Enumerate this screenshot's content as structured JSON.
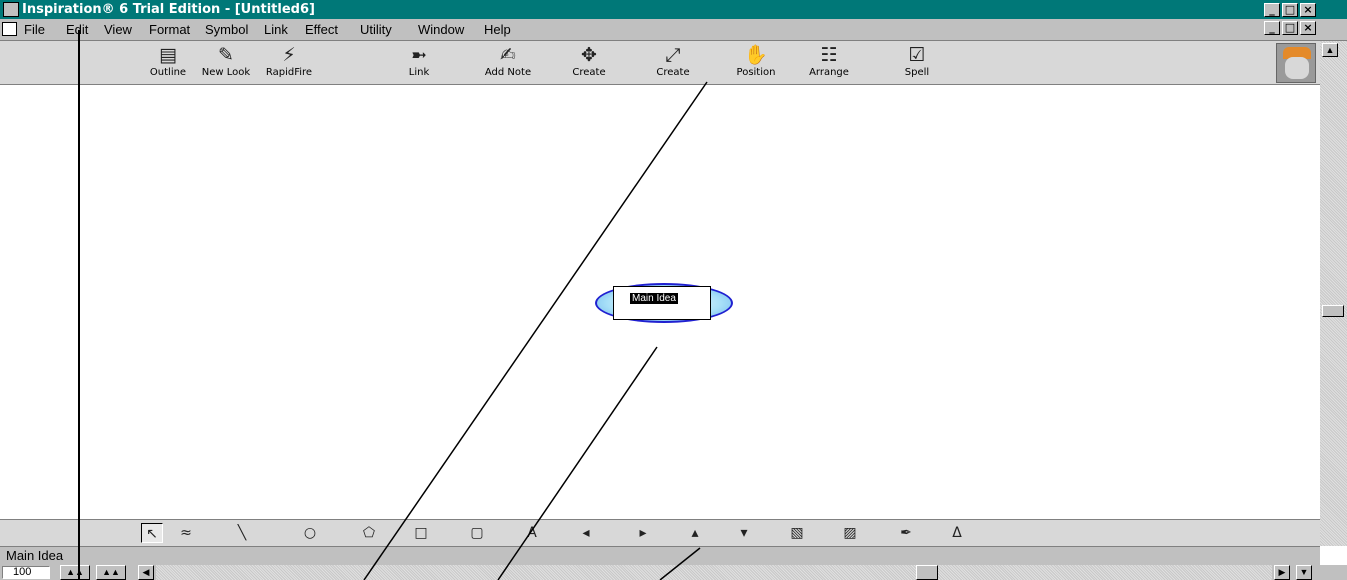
{
  "window": {
    "title": "Inspiration® 6 Trial Edition - [Untitled6]",
    "min": "_",
    "max": "□",
    "close": "×"
  },
  "menu": [
    "File",
    "Edit",
    "View",
    "Format",
    "Symbol",
    "Link",
    "Effect",
    "Utility",
    "Window",
    "Help"
  ],
  "toolbar": [
    {
      "label": "Outline",
      "icon": "outline-icon",
      "glyph": "▤"
    },
    {
      "label": "New Look",
      "icon": "new-look-icon",
      "glyph": "✎"
    },
    {
      "label": "RapidFire",
      "icon": "rapidfire-icon",
      "glyph": "⚡"
    },
    {
      "label": "Link",
      "icon": "link-icon",
      "glyph": "➼"
    },
    {
      "label": "Add Note",
      "icon": "add-note-icon",
      "glyph": "✍"
    },
    {
      "label": "Create",
      "icon": "create-move-icon",
      "glyph": "✥"
    },
    {
      "label": "Create",
      "icon": "create-expand-icon",
      "glyph": "⤢"
    },
    {
      "label": "Position",
      "icon": "position-hand-icon",
      "glyph": "✋"
    },
    {
      "label": "Arrange",
      "icon": "arrange-icon",
      "glyph": "☷"
    },
    {
      "label": "Spell",
      "icon": "spell-check-icon",
      "glyph": "☑"
    }
  ],
  "node": {
    "text": "Main Idea"
  },
  "drawing_tools": [
    {
      "name": "pointer-tool-icon",
      "glyph": "↖"
    },
    {
      "name": "link-tool-icon",
      "glyph": "≈"
    },
    {
      "name": "line-tool-icon",
      "glyph": "╲"
    },
    {
      "name": "oval-tool-icon",
      "glyph": "○"
    },
    {
      "name": "polygon-tool-icon",
      "glyph": "⬠"
    },
    {
      "name": "rectangle-tool-icon",
      "glyph": "□"
    },
    {
      "name": "rounded-rect-tool-icon",
      "glyph": "▢"
    },
    {
      "name": "text-tool-icon",
      "glyph": "A"
    },
    {
      "name": "add-left-icon",
      "glyph": "◂"
    },
    {
      "name": "add-right-icon",
      "glyph": "▸"
    },
    {
      "name": "add-up-icon",
      "glyph": "▴"
    },
    {
      "name": "add-down-icon",
      "glyph": "▾"
    },
    {
      "name": "note-tool-icon",
      "glyph": "▧"
    },
    {
      "name": "edit-note-icon",
      "glyph": "▨"
    },
    {
      "name": "effect-brush-icon",
      "glyph": "✒"
    },
    {
      "name": "font-tool-icon",
      "glyph": "Δ"
    }
  ],
  "status": {
    "text": "Main Idea"
  },
  "zoom": {
    "value": "100"
  }
}
